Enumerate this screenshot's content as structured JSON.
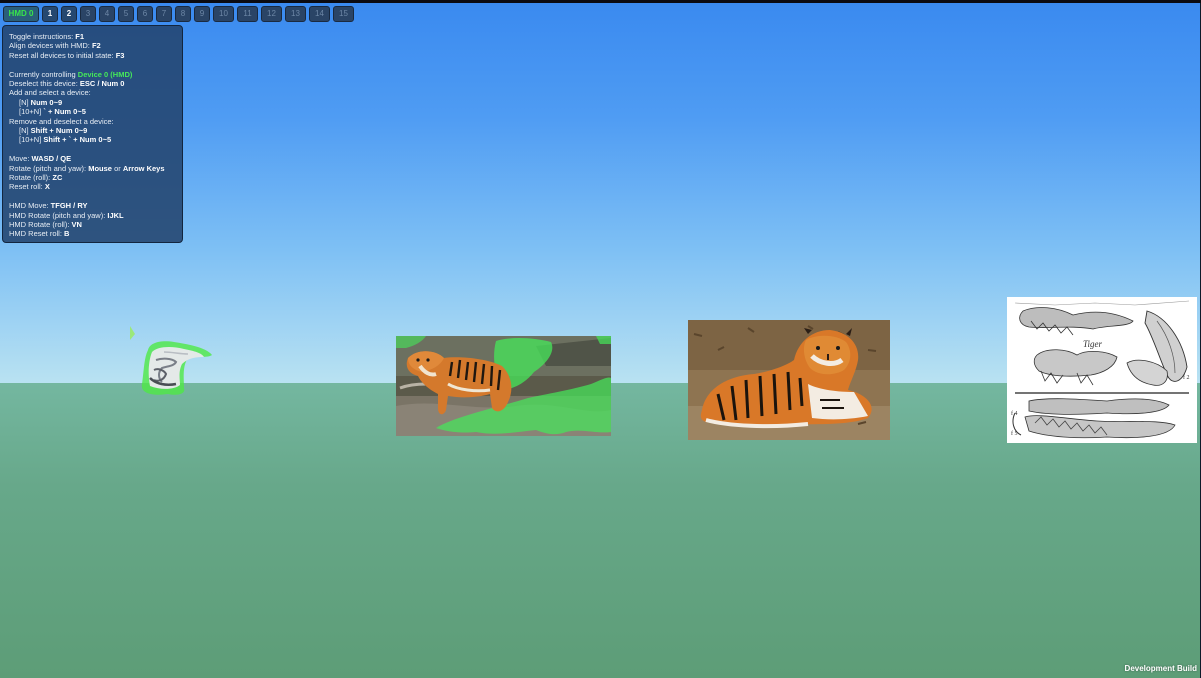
{
  "device_bar": {
    "hmd_label": "HMD 0",
    "devices": [
      "1",
      "2",
      "3",
      "4",
      "5",
      "6",
      "7",
      "8",
      "9",
      "10",
      "11",
      "12",
      "13",
      "14",
      "15"
    ]
  },
  "instructions": {
    "toggle_prefix": "Toggle instructions: ",
    "toggle_key": "F1",
    "align_prefix": "Align devices with HMD: ",
    "align_key": "F2",
    "reset_prefix": "Reset all devices to initial state: ",
    "reset_key": "F3",
    "controlling_prefix": "Currently controlling ",
    "controlling_device": "Device 0 (HMD)",
    "deselect_prefix": "Deselect this device: ",
    "deselect_key": "ESC / Num 0",
    "add_title": "Add and select a device:",
    "add_line1_prefix": "[N] ",
    "add_line1_key": "Num 0~9",
    "add_line2_prefix": "[10+N] ",
    "add_line2_key": "` + Num 0~5",
    "remove_title": "Remove and deselect a device:",
    "remove_line1_prefix": "[N] ",
    "remove_line1_key": "Shift + Num 0~9",
    "remove_line2_prefix": "[10+N] ",
    "remove_line2_key": "Shift + ` + Num 0~5",
    "move_prefix": "Move: ",
    "move_key": "WASD / QE",
    "rotate_prefix": "Rotate (pitch and yaw): ",
    "rotate_key1": "Mouse",
    "rotate_or": " or ",
    "rotate_key2": "Arrow Keys",
    "roll_prefix": "Rotate (roll): ",
    "roll_key": "ZC",
    "reset_roll_prefix": "Reset roll: ",
    "reset_roll_key": "X",
    "hmd_move_prefix": "HMD Move: ",
    "hmd_move_key": "TFGH / RY",
    "hmd_rotate_prefix": "HMD Rotate (pitch and yaw): ",
    "hmd_rotate_key": "IJKL",
    "hmd_roll_prefix": "HMD Rotate (roll): ",
    "hmd_roll_key": "VN",
    "hmd_reset_roll_prefix": "HMD Reset roll: ",
    "hmd_reset_roll_key": "B"
  },
  "scene": {
    "objects": [
      "tiger-3d-shape",
      "tiger-photo-segmented",
      "tiger-photo-lying",
      "tiger-skull-drawing"
    ],
    "drawing_label": "Tiger",
    "colors": {
      "sky_top": "#3a8af0",
      "horizon": "#b9e2f2",
      "ground": "#67a88a",
      "highlight": "#45e85a",
      "panel": "#23446e"
    }
  },
  "footer": {
    "dev_build": "Development Build"
  }
}
